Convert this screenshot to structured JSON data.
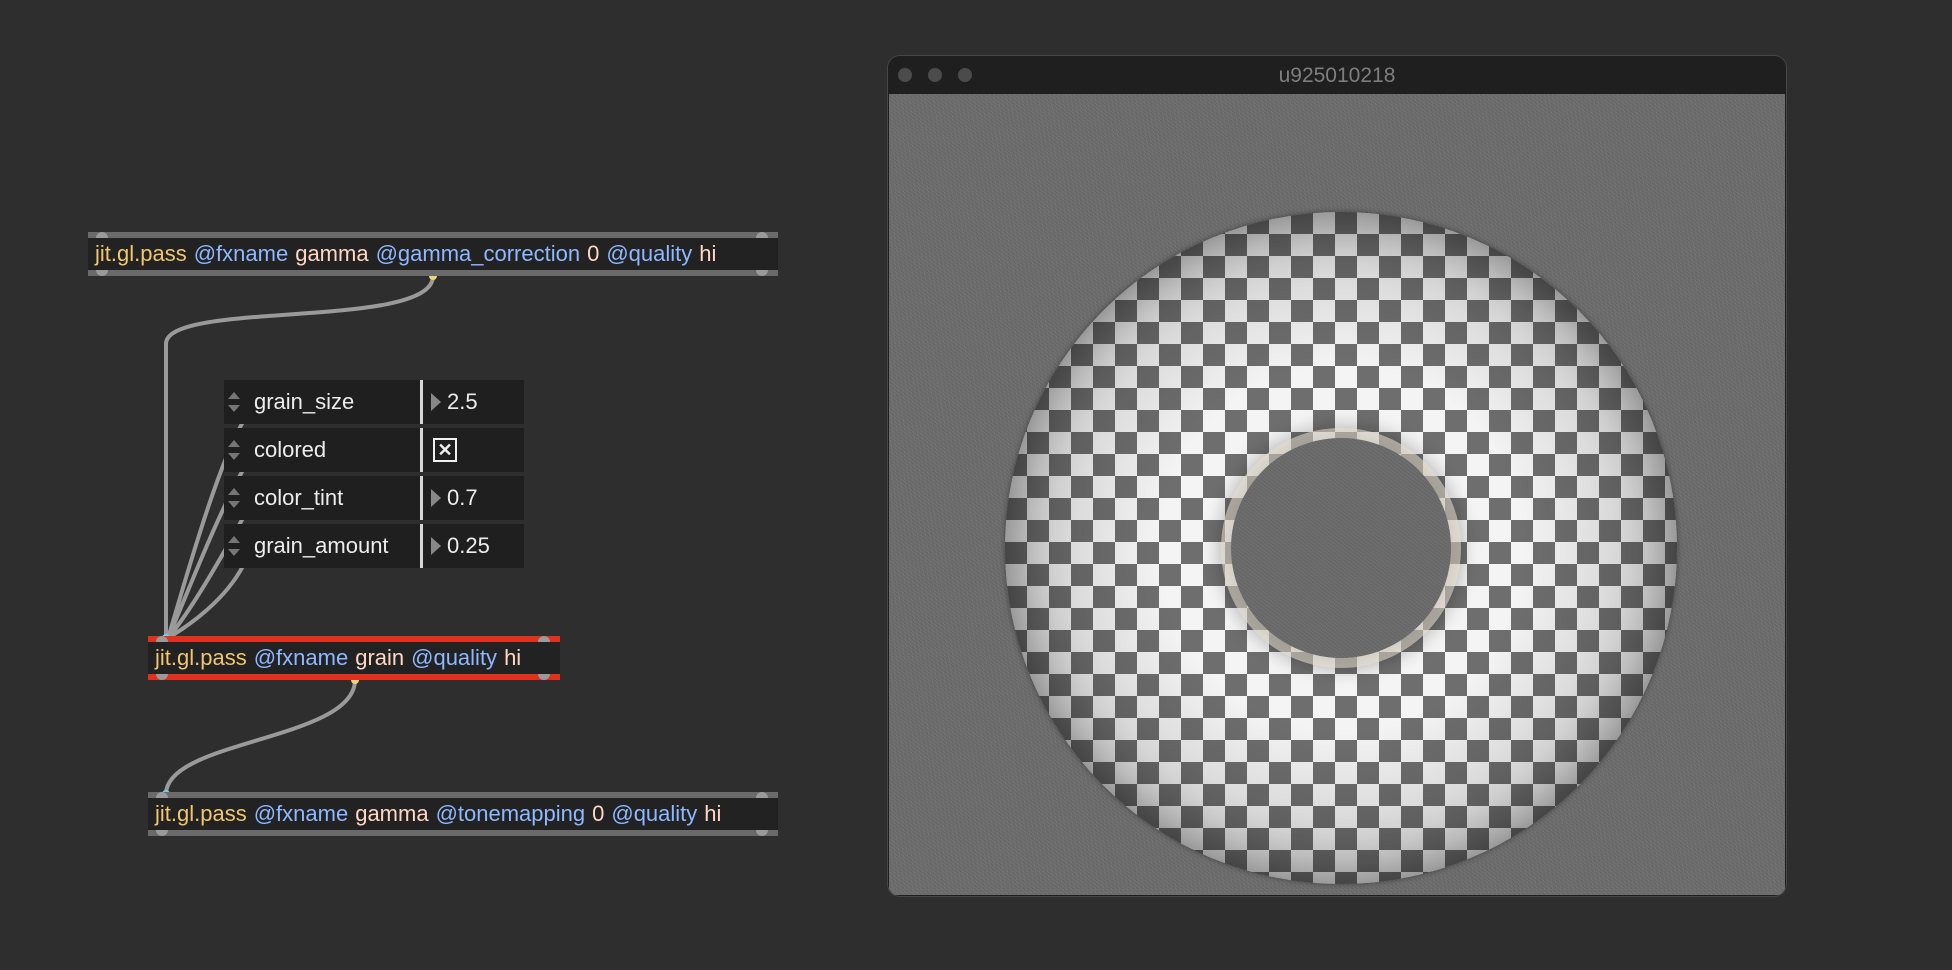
{
  "patch": {
    "objects": [
      {
        "id": "pass_gamma_top",
        "tokens": [
          {
            "text": "jit.gl.pass",
            "kind": "class"
          },
          {
            "text": "@fxname",
            "kind": "attr"
          },
          {
            "text": "gamma",
            "kind": "val"
          },
          {
            "text": "@gamma_correction",
            "kind": "attr"
          },
          {
            "text": "0",
            "kind": "val"
          },
          {
            "text": "@quality",
            "kind": "attr"
          },
          {
            "text": "hi",
            "kind": "val"
          }
        ]
      },
      {
        "id": "pass_grain",
        "selected": true,
        "tokens": [
          {
            "text": "jit.gl.pass",
            "kind": "class"
          },
          {
            "text": "@fxname",
            "kind": "attr"
          },
          {
            "text": "grain",
            "kind": "val"
          },
          {
            "text": "@quality",
            "kind": "attr"
          },
          {
            "text": "hi",
            "kind": "val"
          }
        ]
      },
      {
        "id": "pass_gamma_bottom",
        "tokens": [
          {
            "text": "jit.gl.pass",
            "kind": "class"
          },
          {
            "text": "@fxname",
            "kind": "attr"
          },
          {
            "text": "gamma",
            "kind": "val"
          },
          {
            "text": "@tonemapping",
            "kind": "attr"
          },
          {
            "text": "0",
            "kind": "val"
          },
          {
            "text": "@quality",
            "kind": "attr"
          },
          {
            "text": "hi",
            "kind": "val"
          }
        ]
      }
    ],
    "params": [
      {
        "name": "grain_size",
        "type": "number",
        "value": "2.5"
      },
      {
        "name": "colored",
        "type": "toggle",
        "checked": true,
        "mark": "✕"
      },
      {
        "name": "color_tint",
        "type": "number",
        "value": "0.7"
      },
      {
        "name": "grain_amount",
        "type": "number",
        "value": "0.25"
      }
    ]
  },
  "window": {
    "title": "u925010218"
  },
  "colors": {
    "background": "#2e2e2e",
    "class_name": "#f0c670",
    "attribute": "#8eb8ff",
    "value": "#ffd7c4",
    "selection": "#e0301e"
  }
}
